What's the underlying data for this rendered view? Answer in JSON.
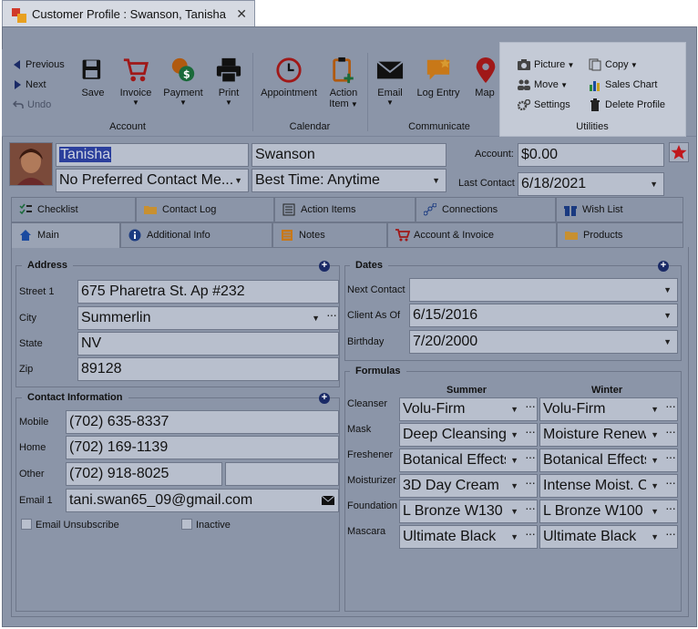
{
  "tab": {
    "title": "Customer Profile : Swanson, Tanisha",
    "close": "✕"
  },
  "ribbon": {
    "nav": {
      "previous": "Previous",
      "next": "Next",
      "undo": "Undo"
    },
    "account": {
      "label": "Account",
      "save": "Save",
      "invoice": "Invoice",
      "payment": "Payment",
      "print": "Print"
    },
    "calendar": {
      "label": "Calendar",
      "appointment": "Appointment",
      "action_item_1": "Action",
      "action_item_2": "Item"
    },
    "communicate": {
      "label": "Communicate",
      "email": "Email",
      "log_entry": "Log Entry",
      "map": "Map"
    },
    "utilities": {
      "label": "Utilities",
      "picture": "Picture",
      "move": "Move",
      "settings": "Settings",
      "copy": "Copy",
      "sales_chart": "Sales Chart",
      "delete_profile": "Delete Profile"
    }
  },
  "profile": {
    "first_name": "Tanisha",
    "last_name": "Swanson",
    "preferred_contact": "No Preferred Contact Me...",
    "best_time": "Best Time: Anytime",
    "account_label": "Account:",
    "account_value": "$0.00",
    "last_contact_label": "Last Contact",
    "last_contact_value": "6/18/2021"
  },
  "tabs_row1": [
    "Checklist",
    "Contact Log",
    "Action Items",
    "Connections",
    "Wish List"
  ],
  "tabs_row2": [
    "Main",
    "Additional Info",
    "Notes",
    "Account & Invoice",
    "Products"
  ],
  "address": {
    "title": "Address",
    "street_label": "Street 1",
    "street": "675 Pharetra St. Ap #232",
    "city_label": "City",
    "city": "Summerlin",
    "state_label": "State",
    "state": "NV",
    "zip_label": "Zip",
    "zip": "89128"
  },
  "contact": {
    "title": "Contact Information",
    "mobile_label": "Mobile",
    "mobile": "(702) 635-8337",
    "home_label": "Home",
    "home": "(702) 169-1139",
    "other_label": "Other",
    "other": "(702) 918-8025",
    "email_label": "Email 1",
    "email": "tani.swan65_09@gmail.com",
    "unsubscribe": "Email Unsubscribe",
    "inactive": "Inactive"
  },
  "dates": {
    "title": "Dates",
    "next_contact_label": "Next Contact",
    "next_contact": "",
    "client_as_of_label": "Client As Of",
    "client_as_of": "6/15/2016",
    "birthday_label": "Birthday",
    "birthday": "7/20/2000"
  },
  "formulas": {
    "title": "Formulas",
    "summer": "Summer",
    "winter": "Winter",
    "rows": [
      {
        "label": "Cleanser",
        "summer": "Volu-Firm",
        "winter": "Volu-Firm"
      },
      {
        "label": "Mask",
        "summer": "Deep Cleansing",
        "winter": "Moisture Renew"
      },
      {
        "label": "Freshener",
        "summer": "Botanical Effects",
        "winter": "Botanical Effects"
      },
      {
        "label": "Moisturizer",
        "summer": "3D Day Cream",
        "winter": "Intense Moist. C"
      },
      {
        "label": "Foundation",
        "summer": "L Bronze W130",
        "winter": "L Bronze W100"
      },
      {
        "label": "Mascara",
        "summer": "Ultimate Black",
        "winter": "Ultimate Black"
      }
    ]
  },
  "colors": {
    "overlay": "#8b95a8",
    "highlight": "#c4cad6",
    "accent_red": "#c0171c",
    "field": "#b8bfcd"
  }
}
